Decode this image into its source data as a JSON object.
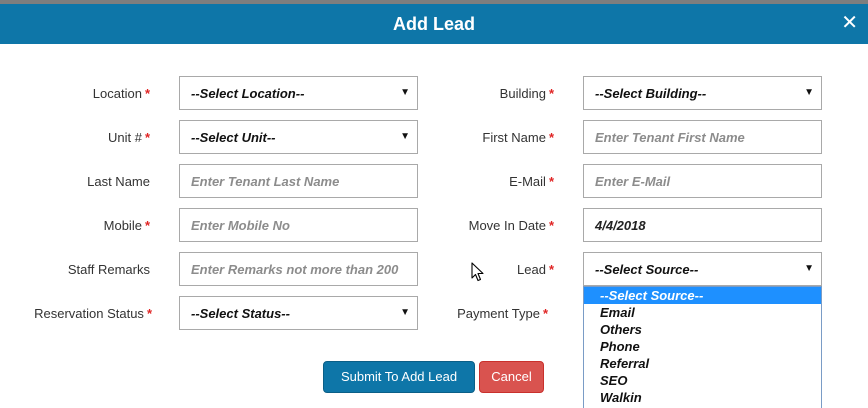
{
  "header": {
    "title": "Add Lead",
    "close_glyph": "✕"
  },
  "form": {
    "location": {
      "label": "Location",
      "value": "--Select Location--"
    },
    "building": {
      "label": "Building",
      "value": "--Select Building--"
    },
    "unit": {
      "label": "Unit #",
      "value": "--Select Unit--"
    },
    "first_name": {
      "label": "First Name",
      "placeholder": "Enter Tenant First Name"
    },
    "last_name": {
      "label": "Last Name",
      "placeholder": "Enter Tenant Last Name"
    },
    "email": {
      "label": "E-Mail",
      "placeholder": "Enter E-Mail"
    },
    "mobile": {
      "label": "Mobile",
      "placeholder": "Enter Mobile No"
    },
    "move_in_date": {
      "label": "Move In Date",
      "value": "4/4/2018"
    },
    "staff_remarks": {
      "label": "Staff Remarks",
      "placeholder": "Enter Remarks not more than 200"
    },
    "lead": {
      "label": "Lead",
      "value": "--Select Source--"
    },
    "reservation_status": {
      "label": "Reservation Status",
      "value": "--Select Status--"
    },
    "payment_type": {
      "label": "Payment Type"
    },
    "required_marker": "*"
  },
  "lead_options": [
    "--Select Source--",
    "Email",
    "Others",
    "Phone",
    "Referral",
    "SEO",
    "Walkin"
  ],
  "buttons": {
    "submit": "Submit To Add Lead",
    "cancel": "Cancel"
  },
  "colors": {
    "primary": "#0e76a8",
    "danger": "#d9534f",
    "required": "#e02424",
    "highlight": "#1e90ff"
  }
}
